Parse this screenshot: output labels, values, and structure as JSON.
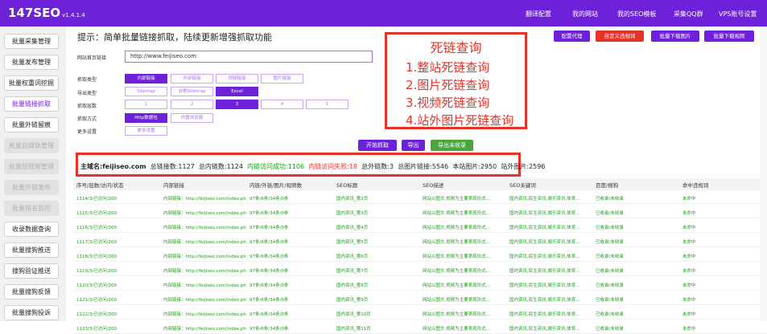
{
  "app": {
    "name": "147SEO",
    "version": "v1.4.1.4"
  },
  "topnav": [
    "翻译配置",
    "我的网站",
    "我的SEO模板",
    "采集QQ群",
    "VPS账号设置"
  ],
  "sidebar": [
    {
      "label": "批量采集管理",
      "state": "normal"
    },
    {
      "label": "批量发布管理",
      "state": "normal"
    },
    {
      "label": "批量权重词挖掘",
      "state": "normal"
    },
    {
      "label": "批量链接抓取",
      "state": "active"
    },
    {
      "label": "批量外链留痕",
      "state": "normal"
    },
    {
      "label": "批量自媒体管理",
      "state": "disabled"
    },
    {
      "label": "批量短视频管理",
      "state": "disabled"
    },
    {
      "label": "批量外链发布",
      "state": "disabled"
    },
    {
      "label": "批量排名监控",
      "state": "disabled"
    },
    {
      "label": "收录数据查询",
      "state": "normal"
    },
    {
      "label": "批量搜狗推送",
      "state": "normal"
    },
    {
      "label": "搜狗验证推送",
      "state": "normal"
    },
    {
      "label": "批量搜狗反馈",
      "state": "normal"
    },
    {
      "label": "批量搜狗投诉",
      "state": "normal"
    }
  ],
  "tip": "提示：简单批量链接抓取，陆续更新增强抓取功能",
  "form": {
    "url_label": "网站首页链接",
    "url_value": "http://www.feijiseo.com",
    "crawl_type_label": "抓取类型",
    "crawl_types": [
      "内部链接",
      "外部链接",
      "视频链接",
      "图片链接"
    ],
    "export_label": "导出类型",
    "export_types": [
      "Sitemap",
      "谷歌Sitemap",
      "Excel"
    ],
    "depth_label": "抓取层数",
    "depths": [
      "1",
      "2",
      "3",
      "4",
      "5"
    ],
    "method_label": "抓取方式",
    "methods": [
      "Http数据包",
      "内置浏览器"
    ],
    "more_label": "更多设置",
    "more_button": "更多设置"
  },
  "top_buttons": [
    "配置代理",
    "自定义违规词",
    "批量下载图片",
    "批量下载视频"
  ],
  "actions": {
    "start": "开始抓取",
    "export": "导出",
    "export_unindexed": "导出未收录"
  },
  "callout": {
    "title": "死链查询",
    "items": [
      "1.整站死链查询",
      "2.图片死链查询",
      "3.视频死链查询",
      "4.站外图片死链查询"
    ]
  },
  "stats": {
    "domain": "主域名:feijiseo.com",
    "total": "总链接数:1127",
    "internal": "总内链数:1124",
    "success": "内链访问成功:1106",
    "failed": "内链访问失败:18",
    "external": "总外链数:3",
    "images": "总图片链接:5546",
    "local_images": "本站图片:2950",
    "offsite_images": "站外图片:2596"
  },
  "colors": {
    "primary": "#6d21d8",
    "danger": "#e5332a",
    "success": "#4aa53b"
  },
  "table": {
    "headers": [
      "序号/层数/访问/状态",
      "内部链接",
      "内链/外链/图片/视频数",
      "SEO标题",
      "SEO描述",
      "SEO关键词",
      "百度/搜狗",
      "命中违规词"
    ],
    "rows": [
      [
        "1114/3/已访问/200",
        "内部链接：http://feijiseo.com/index.ph",
        "97条/6条/34条/0条",
        "国内资讯_第2页",
        "网站以图文,视频为主要表现形式...",
        "国内资讯,民生资讯,娱乐资讯,体育...",
        "已收录/未收录",
        "未命中"
      ],
      [
        "1115/3/已访问/200",
        "内部链接：http://feijiseo.com/index.ph",
        "97条/6条/34条/0条",
        "国内资讯_第3页",
        "网站以图文,视频为主要表现形式...",
        "国内资讯,民生资讯,娱乐资讯,体育...",
        "已收录/未收录",
        "未命中"
      ],
      [
        "1116/3/已访问/200",
        "内部链接：http://feijiseo.com/index.ph",
        "97条/6条/34条/0条",
        "国内资讯_第4页",
        "网站以图文,视频为主要表现形式...",
        "国内资讯,民生资讯,娱乐资讯,体育...",
        "已收录/未收录",
        "未命中"
      ],
      [
        "1117/3/已访问/200",
        "内部链接：http://feijiseo.com/index.ph",
        "97条/6条/34条/0条",
        "国内资讯_第5页",
        "网站以图文,视频为主要表现形式...",
        "国内资讯,民生资讯,娱乐资讯,体育...",
        "已收录/未收录",
        "未命中"
      ],
      [
        "1118/3/已访问/200",
        "内部链接：http://feijiseo.com/index.ph",
        "97条/6条/34条/0条",
        "国内资讯_第6页",
        "网站以图文,视频为主要表现形式...",
        "国内资讯,民生资讯,娱乐资讯,体育...",
        "已收录/未收录",
        "未命中"
      ],
      [
        "1119/3/已访问/200",
        "内部链接：http://feijiseo.com/index.ph",
        "97条/6条/34条/0条",
        "国内资讯_第7页",
        "网站以图文,视频为主要表现形式...",
        "国内资讯,民生资讯,娱乐资讯,体育...",
        "已收录/未收录",
        "未命中"
      ],
      [
        "1120/3/已访问/200",
        "内部链接：http://feijiseo.com/index.ph",
        "97条/6条/34条/0条",
        "国内资讯_第8页",
        "网站以图文,视频为主要表现形式...",
        "国内资讯,民生资讯,娱乐资讯,体育...",
        "已收录/未收录",
        "未命中"
      ],
      [
        "1121/3/已访问/200",
        "内部链接：http://feijiseo.com/index.ph",
        "97条/6条/34条/0条",
        "国内资讯_第9页",
        "网站以图文,视频为主要表现形式...",
        "国内资讯,民生资讯,娱乐资讯,体育...",
        "已收录/未收录",
        "未命中"
      ],
      [
        "1122/3/已访问/200",
        "内部链接：http://feijiseo.com/index.ph",
        "97条/6条/34条/0条",
        "国内资讯_第10页",
        "网站以图文,视频为主要表现形式...",
        "国内资讯,民生资讯,娱乐资讯,体育...",
        "已收录/未收录",
        "未命中"
      ],
      [
        "1123/3/已访问/200",
        "内部链接：http://feijiseo.com/index.ph",
        "97条/6条/34条/0条",
        "国内资讯_第11页",
        "网站以图文,视频为主要表现形式...",
        "国内资讯,民生资讯,娱乐资讯,体育...",
        "已收录/未收录",
        "未命中"
      ]
    ]
  }
}
